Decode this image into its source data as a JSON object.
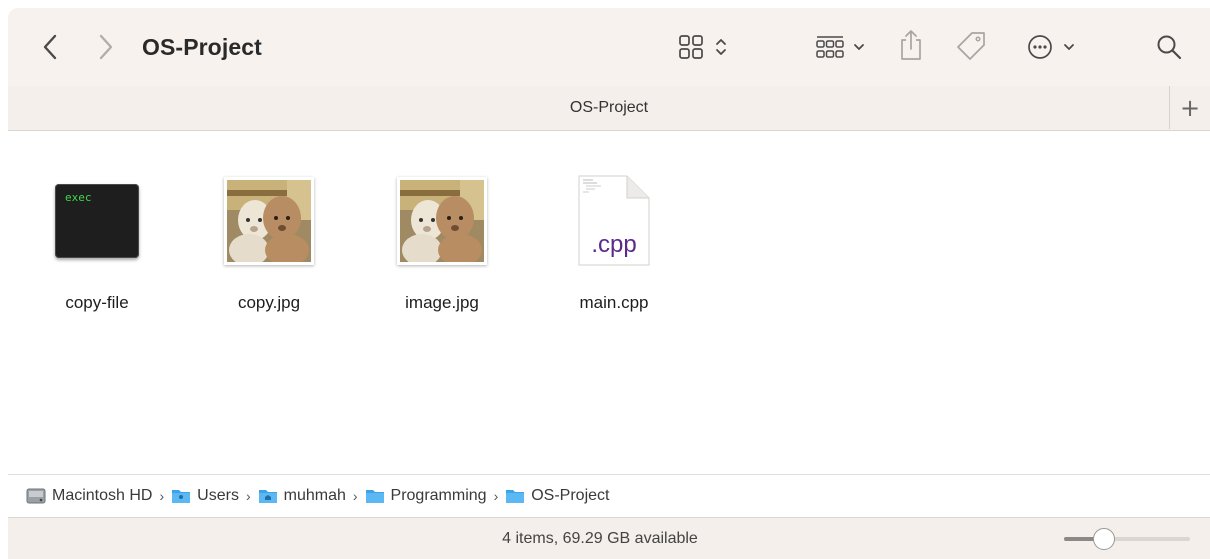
{
  "window": {
    "title": "OS-Project"
  },
  "toolbar": {
    "back_icon": "chevron-left-icon",
    "forward_icon": "chevron-right-icon",
    "view_icon": "icon-grid-view-icon",
    "group_icon": "group-by-icon",
    "share_icon": "share-icon",
    "tag_icon": "tag-icon",
    "more_icon": "ellipsis-circle-icon",
    "search_icon": "search-icon"
  },
  "tab": {
    "label": "OS-Project",
    "add_label": "+"
  },
  "files": [
    {
      "name": "copy-file",
      "kind": "exec",
      "badge": "exec"
    },
    {
      "name": "copy.jpg",
      "kind": "image"
    },
    {
      "name": "image.jpg",
      "kind": "image"
    },
    {
      "name": "main.cpp",
      "kind": "cpp",
      "badge": ".cpp"
    }
  ],
  "pathbar": {
    "items": [
      "Macintosh HD",
      "Users",
      "muhmah",
      "Programming",
      "OS-Project"
    ]
  },
  "status": {
    "text": "4 items, 69.29 GB available",
    "icon_size_level": 0.28
  },
  "colors": {
    "toolbar_bg": "#f7f2ee",
    "folder_blue": "#3ba3e8",
    "exec_green": "#41d64b",
    "cpp_purple": "#5b2a8c"
  }
}
